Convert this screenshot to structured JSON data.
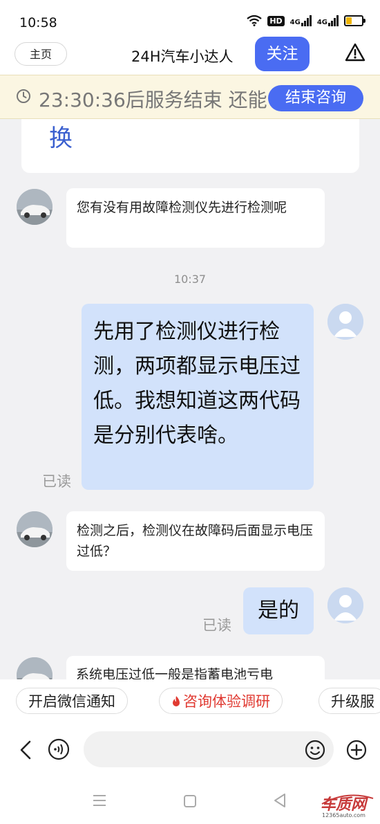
{
  "status_bar": {
    "time": "10:58",
    "hd_label": "HD",
    "signal1_label": "4G",
    "signal2_label": "4G"
  },
  "nav": {
    "home_label": "主页",
    "title": "24H汽车小达人",
    "follow_label": "关注"
  },
  "banner": {
    "text": "23:30:36后服务结束 还能",
    "end_label": "结束咨询"
  },
  "chat": {
    "previous_fragment": "换",
    "messages": [
      {
        "from": "agent",
        "text": "您有没有用故障检测仪先进行检测呢"
      },
      {
        "type": "timestamp",
        "text": "10:37"
      },
      {
        "from": "user",
        "text": "先用了检测仪进行检测，两项都显示电压过低。我想知道这两代码是分别代表啥。",
        "read": "已读"
      },
      {
        "from": "agent",
        "text": "检测之后，检测仪在故障码后面显示电压过低？"
      },
      {
        "from": "user",
        "text": "是的",
        "read": "已读"
      },
      {
        "from": "agent",
        "text": "系统电压过低一般是指蓄电池亏电"
      }
    ]
  },
  "chips": {
    "wechat_label": "开启微信通知",
    "survey_label": "咨询体验调研",
    "upgrade_label": "升级服"
  },
  "input": {
    "placeholder": ""
  },
  "colors": {
    "accent": "#4a6cf2",
    "user_bubble": "#d2e2fb",
    "banner_bg": "#fbf6e2",
    "chat_bg": "#f1f1f3",
    "hot_red": "#e03a32"
  },
  "watermark": {
    "brand": "车质网",
    "url": "12365auto.com"
  }
}
